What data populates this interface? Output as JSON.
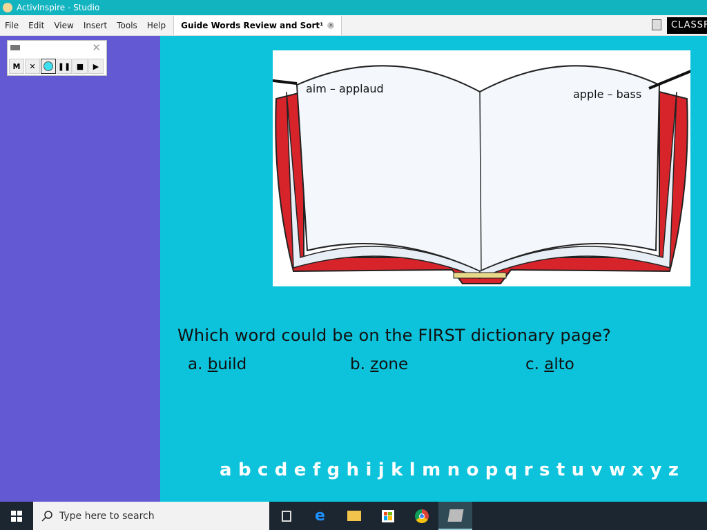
{
  "window": {
    "title": "ActivInspire - Studio"
  },
  "menu": [
    "File",
    "Edit",
    "View",
    "Insert",
    "Tools",
    "Help"
  ],
  "tab": {
    "label": "Guide Words Review and Sort¹",
    "close": "×"
  },
  "classflow_label": "CLASSF",
  "recorder": {
    "buttons": [
      "M",
      "✕",
      "",
      "❚❚",
      "■",
      "▶"
    ],
    "close": "✕"
  },
  "book": {
    "left_guide": "aim – applaud",
    "right_guide": "apple – bass"
  },
  "question": "Which word could be on the FIRST dictionary page?",
  "answers": [
    {
      "letter": "a.",
      "first": "b",
      "rest": "uild"
    },
    {
      "letter": "b.",
      "first": "z",
      "rest": "one"
    },
    {
      "letter": "c.",
      "first": "a",
      "rest": "lto"
    }
  ],
  "alphabet": "abcdefghijklmnopqrstuvwxyz",
  "taskbar": {
    "search_placeholder": "Type here to search",
    "apps": [
      "task-view",
      "edge",
      "file-explorer",
      "store",
      "chrome",
      "activinspire"
    ]
  },
  "colors": {
    "canvas": "#0cc3db",
    "sidebar": "#6359d3",
    "book_cover": "#d7242b"
  }
}
